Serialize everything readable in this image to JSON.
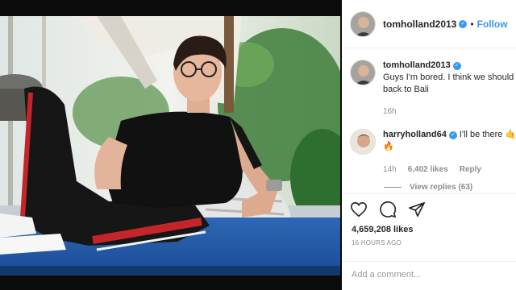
{
  "post": {
    "username": "tomholland2013",
    "follow_label": "Follow",
    "separator": "•",
    "caption": {
      "username": "tomholland2013",
      "text": "Guys I'm bored. I think we should",
      "text_line2": "back to Bali",
      "age": "16h"
    },
    "comment": {
      "username": "harryholland64",
      "text": "I'll be there",
      "emoji_1": "🤙",
      "emoji_2": "🔥",
      "age": "14h",
      "likes": "6,402 likes",
      "reply_label": "Reply",
      "view_replies": "View replies (63)"
    },
    "likes_count": "4,659,208 likes",
    "posted_time": "16 HOURS AGO",
    "add_comment_placeholder": "Add a comment...",
    "icons": [
      "heart-icon",
      "comment-icon",
      "share-icon"
    ]
  },
  "colors": {
    "accent": "#3897f0",
    "muted_text": "#8e8e8e",
    "panel_bg": "#ffffff",
    "page_bg": "#0c0c0c"
  }
}
